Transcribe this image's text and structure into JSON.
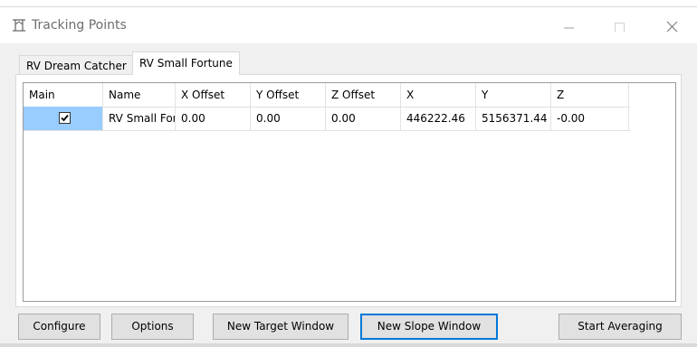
{
  "window": {
    "title": "Tracking Points"
  },
  "tabs": [
    {
      "label": "RV Dream Catcher",
      "selected": false
    },
    {
      "label": "RV Small Fortune",
      "selected": true
    }
  ],
  "table": {
    "columns": [
      "Main",
      "Name",
      "X Offset",
      "Y Offset",
      "Z Offset",
      "X",
      "Y",
      "Z"
    ],
    "rows": [
      {
        "main_checked": true,
        "name": "RV Small For",
        "x_offset": "0.00",
        "y_offset": "0.00",
        "z_offset": "0.00",
        "x": "446222.46",
        "y": "5156371.44",
        "z": "-0.00"
      }
    ]
  },
  "buttons": {
    "configure": "Configure",
    "options": "Options",
    "new_target_window": "New Target Window",
    "new_slope_window": "New Slope Window",
    "start_averaging": "Start Averaging"
  },
  "colors": {
    "selection": "#99ccff",
    "focus_border": "#0078d7",
    "button_face": "#e1e1e1"
  },
  "icons": {
    "app": "tracking-points-icon",
    "minimize": "minimize-icon",
    "maximize": "maximize-icon",
    "close": "close-icon",
    "check": "checkmark-icon"
  }
}
